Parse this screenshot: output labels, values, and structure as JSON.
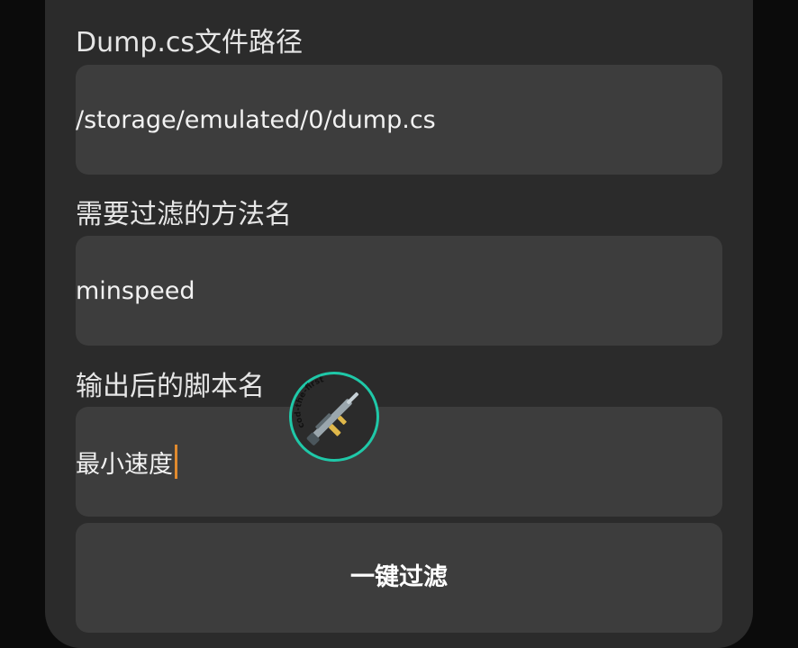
{
  "form": {
    "dump_path": {
      "label": "Dump.cs文件路径",
      "value": "/storage/emulated/0/dump.cs"
    },
    "method_name": {
      "label": "需要过滤的方法名",
      "value": "minspeed"
    },
    "script_name": {
      "label": "输出后的脚本名",
      "value": "最小速度"
    },
    "filter_button_label": "一键过滤"
  },
  "overlay_badge": {
    "icon": "rifle-icon",
    "text": "cod-the-first",
    "ring_color": "#1fc8a8"
  },
  "colors": {
    "background": "#0b0b0b",
    "card": "#2b2b2b",
    "field": "#3d3d3d",
    "caret": "#e08a2e"
  }
}
